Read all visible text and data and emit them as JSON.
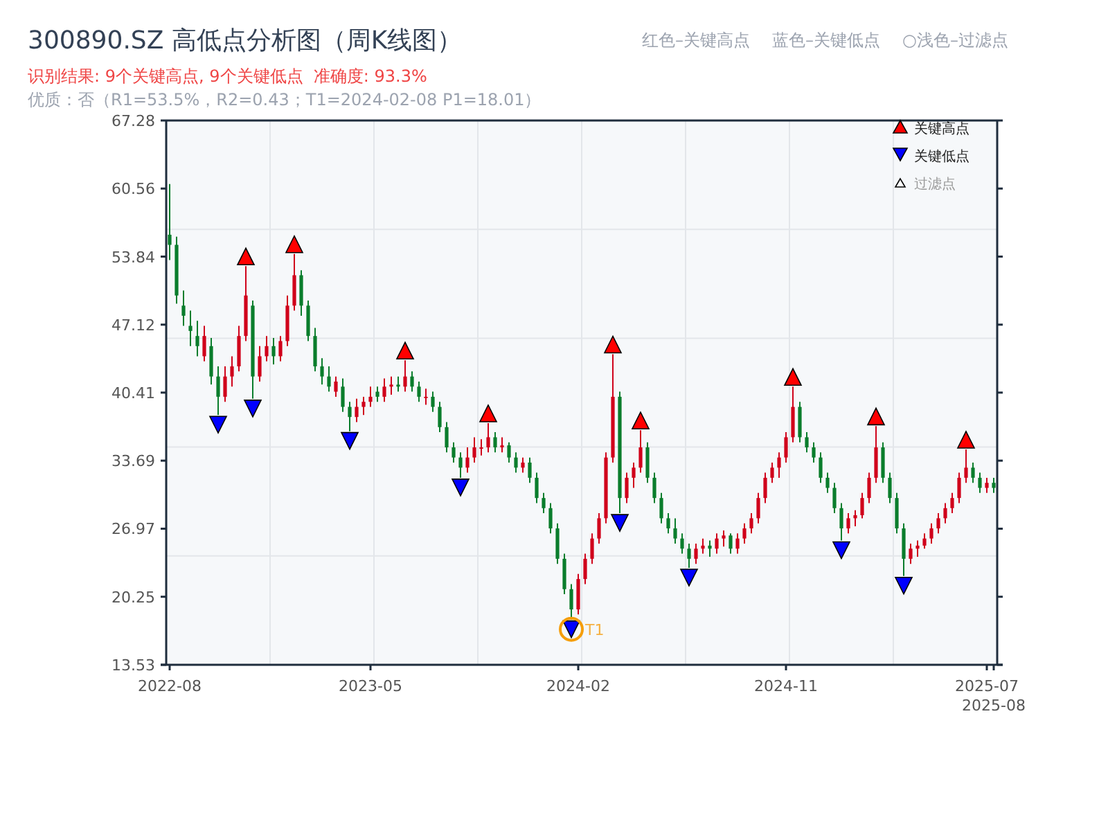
{
  "title": "300890.SZ 高低点分析图（周K线图）",
  "legend_top": [
    "红色–关键高点",
    "蓝色–关键低点",
    "○浅色–过滤点"
  ],
  "result_line": "识别结果: 9个关键高点, 9个关键低点  准确度: 93.3%",
  "quality_line": "优质：否（R1=53.5%，R2=0.43；T1=2024-02-08 P1=18.01）",
  "chart": {
    "chart_data": {
      "type": "candlestick",
      "categories": [
        "2022-08",
        null,
        null,
        null,
        null,
        null,
        null,
        null,
        null,
        null,
        null,
        null,
        null,
        null,
        null,
        null,
        null,
        null,
        null,
        null,
        null,
        null,
        null,
        null,
        null,
        null,
        null,
        null,
        null,
        "2023-05",
        null,
        null,
        null,
        null,
        null,
        null,
        null,
        null,
        null,
        null,
        null,
        null,
        null,
        null,
        null,
        null,
        null,
        null,
        null,
        null,
        null,
        null,
        null,
        null,
        null,
        null,
        null,
        null,
        null,
        "2024-02",
        null,
        null,
        null,
        null,
        null,
        null,
        null,
        null,
        null,
        null,
        null,
        null,
        null,
        null,
        null,
        null,
        null,
        null,
        null,
        null,
        null,
        null,
        null,
        null,
        null,
        null,
        null,
        null,
        null,
        "2024-11",
        null,
        null,
        null,
        null,
        null,
        null,
        null,
        null,
        null,
        null,
        null,
        null,
        null,
        null,
        null,
        null,
        null,
        null,
        null,
        null,
        null,
        null,
        null,
        null,
        null,
        null,
        null,
        null,
        "2025-07",
        "2025-08"
      ],
      "ohlc": [
        [
          56,
          61,
          53.5,
          55
        ],
        [
          55,
          55.8,
          49.2,
          50
        ],
        [
          49,
          50.5,
          47,
          48
        ],
        [
          47,
          48.5,
          45,
          46.5
        ],
        [
          46,
          47.5,
          44,
          45
        ],
        [
          44,
          47,
          43.5,
          46
        ],
        [
          45,
          45.8,
          41.2,
          42
        ],
        [
          42,
          43,
          38.2,
          40
        ],
        [
          40,
          43,
          39.5,
          42
        ],
        [
          42,
          44,
          41,
          43
        ],
        [
          43,
          47,
          42.5,
          46
        ],
        [
          46,
          52.9,
          45.5,
          50
        ],
        [
          49,
          49.5,
          39.8,
          42
        ],
        [
          42,
          45,
          41.5,
          44
        ],
        [
          44,
          46,
          43.5,
          45
        ],
        [
          45,
          45.8,
          43.2,
          44
        ],
        [
          44,
          46,
          43.5,
          45.5
        ],
        [
          45.5,
          50,
          45,
          49
        ],
        [
          49,
          54.1,
          48.5,
          52
        ],
        [
          52,
          52.5,
          48,
          49
        ],
        [
          49,
          49.5,
          45.5,
          46
        ],
        [
          46,
          46.8,
          42.5,
          43
        ],
        [
          43,
          43.8,
          41.2,
          42
        ],
        [
          42,
          43,
          40.5,
          41
        ],
        [
          40.5,
          42,
          40,
          41.5
        ],
        [
          41,
          41.8,
          38.5,
          39
        ],
        [
          39,
          39.5,
          36.6,
          38
        ],
        [
          38,
          39.8,
          37.5,
          39
        ],
        [
          39,
          40,
          38.2,
          39.5
        ],
        [
          39.5,
          41,
          39,
          40
        ],
        [
          40.5,
          41,
          39.5,
          40
        ],
        [
          40,
          41.8,
          39.5,
          41
        ],
        [
          41,
          42,
          40.2,
          41.2
        ],
        [
          41.2,
          42,
          40.5,
          41
        ],
        [
          41,
          43.6,
          40.5,
          42
        ],
        [
          42,
          42.5,
          40.5,
          41
        ],
        [
          41,
          41.5,
          39.5,
          40
        ],
        [
          40,
          40.8,
          39.2,
          40
        ],
        [
          40,
          40.5,
          38.5,
          39
        ],
        [
          39,
          39.5,
          36.5,
          37
        ],
        [
          37,
          37.5,
          34.5,
          35
        ],
        [
          35,
          35.5,
          33.5,
          34
        ],
        [
          34,
          34.5,
          32,
          33
        ],
        [
          33,
          35,
          32.5,
          34
        ],
        [
          34,
          36,
          33.5,
          35
        ],
        [
          35,
          35.8,
          34.2,
          35
        ],
        [
          35,
          37.4,
          34.5,
          36
        ],
        [
          36,
          36.5,
          34.5,
          35
        ],
        [
          35,
          36,
          34.5,
          35.2
        ],
        [
          35.2,
          35.5,
          33.5,
          34
        ],
        [
          34,
          34.5,
          32.5,
          33
        ],
        [
          33,
          34,
          32.5,
          33.5
        ],
        [
          33.5,
          34,
          31.5,
          32
        ],
        [
          32,
          32.5,
          29.5,
          30
        ],
        [
          30,
          30.5,
          28.5,
          29
        ],
        [
          29,
          29.5,
          26.5,
          27
        ],
        [
          27,
          27.5,
          23.5,
          24
        ],
        [
          24,
          24.5,
          20.5,
          21
        ],
        [
          21,
          21.5,
          18,
          19
        ],
        [
          19,
          22.5,
          18.5,
          22
        ],
        [
          22,
          24.5,
          21.5,
          24
        ],
        [
          24,
          26.5,
          23.5,
          26
        ],
        [
          26,
          28.5,
          25.5,
          28
        ],
        [
          28,
          34.5,
          27.5,
          34
        ],
        [
          34,
          44.2,
          33.5,
          40
        ],
        [
          40,
          40.5,
          28.5,
          30
        ],
        [
          30,
          32.5,
          29.5,
          32
        ],
        [
          32,
          33.5,
          31,
          33
        ],
        [
          33,
          36.7,
          32.5,
          35
        ],
        [
          35,
          35.5,
          31.5,
          32
        ],
        [
          32,
          32.5,
          29.5,
          30
        ],
        [
          30,
          30.5,
          27.5,
          28
        ],
        [
          28,
          28.5,
          26.5,
          27
        ],
        [
          27,
          28,
          25.5,
          26
        ],
        [
          26,
          26.5,
          24.5,
          25
        ],
        [
          25,
          25.5,
          23.1,
          24
        ],
        [
          24,
          25.5,
          23.5,
          25
        ],
        [
          25,
          26,
          24.5,
          25.3
        ],
        [
          25.3,
          25.8,
          24.2,
          25
        ],
        [
          25,
          26.5,
          24.5,
          26
        ],
        [
          26,
          26.8,
          25.2,
          26.3
        ],
        [
          26.3,
          26.5,
          24.5,
          25
        ],
        [
          25,
          26.5,
          24.5,
          26
        ],
        [
          26,
          27.5,
          25.5,
          27
        ],
        [
          27,
          28.5,
          26.5,
          28
        ],
        [
          28,
          30.5,
          27.5,
          30
        ],
        [
          30,
          32.5,
          29.5,
          32
        ],
        [
          32,
          33.5,
          31.5,
          33
        ],
        [
          33,
          34.5,
          32,
          34
        ],
        [
          34,
          36.5,
          33.5,
          36
        ],
        [
          36,
          41,
          35.5,
          39
        ],
        [
          39,
          39.5,
          35.5,
          36
        ],
        [
          36,
          36.5,
          34.5,
          35
        ],
        [
          35,
          35.5,
          33.5,
          34
        ],
        [
          34,
          34.5,
          31.5,
          32
        ],
        [
          32,
          32.5,
          30.5,
          31
        ],
        [
          31,
          31.5,
          28.5,
          29
        ],
        [
          29,
          29.5,
          25.8,
          27
        ],
        [
          27,
          28.5,
          26.5,
          28
        ],
        [
          28,
          28.8,
          27.2,
          28.3
        ],
        [
          28.3,
          30.5,
          28,
          30
        ],
        [
          30,
          32.5,
          29.5,
          32
        ],
        [
          32,
          37.1,
          31.5,
          35
        ],
        [
          35,
          35.5,
          31.5,
          32
        ],
        [
          32,
          32.5,
          29.5,
          30
        ],
        [
          30,
          30.5,
          26.5,
          27
        ],
        [
          27,
          27.5,
          22.3,
          24
        ],
        [
          24,
          25.5,
          23.5,
          25
        ],
        [
          25,
          25.8,
          24.2,
          25.3
        ],
        [
          25.3,
          26.5,
          25,
          26
        ],
        [
          26,
          27.5,
          25.5,
          27
        ],
        [
          27,
          28.5,
          26.5,
          28
        ],
        [
          28,
          29.5,
          27.5,
          29
        ],
        [
          29,
          30.5,
          28.5,
          30
        ],
        [
          30,
          32.5,
          29.5,
          32
        ],
        [
          32,
          34.8,
          31.5,
          33
        ],
        [
          33,
          33.5,
          31.5,
          32
        ],
        [
          32,
          32.5,
          30.5,
          31
        ],
        [
          31,
          32,
          30.5,
          31.5
        ],
        [
          31.5,
          32,
          30.5,
          31
        ]
      ],
      "ylim": [
        13.53,
        67.28
      ],
      "yticks": [
        13.53,
        20.25,
        26.97,
        33.69,
        40.41,
        47.12,
        53.84,
        60.56,
        67.28
      ],
      "annotations": [
        "T1"
      ]
    },
    "key_high": [
      false,
      false,
      false,
      false,
      false,
      false,
      false,
      false,
      false,
      false,
      false,
      true,
      false,
      false,
      false,
      false,
      false,
      false,
      true,
      false,
      false,
      false,
      false,
      false,
      false,
      false,
      false,
      false,
      false,
      false,
      false,
      false,
      false,
      false,
      true,
      false,
      false,
      false,
      false,
      false,
      false,
      false,
      false,
      false,
      false,
      false,
      true,
      false,
      false,
      false,
      false,
      false,
      false,
      false,
      false,
      false,
      false,
      false,
      false,
      false,
      false,
      false,
      false,
      false,
      true,
      false,
      false,
      false,
      true,
      false,
      false,
      false,
      false,
      false,
      false,
      false,
      false,
      false,
      false,
      false,
      false,
      false,
      false,
      false,
      false,
      false,
      false,
      false,
      false,
      false,
      true,
      false,
      false,
      false,
      false,
      false,
      false,
      false,
      false,
      false,
      false,
      false,
      true,
      false,
      false,
      false,
      false,
      false,
      false,
      false,
      false,
      false,
      false,
      false,
      false,
      true,
      false,
      false,
      false,
      false
    ],
    "key_low": [
      false,
      false,
      false,
      false,
      false,
      false,
      false,
      true,
      false,
      false,
      false,
      false,
      true,
      false,
      false,
      false,
      false,
      false,
      false,
      false,
      false,
      false,
      false,
      false,
      false,
      false,
      true,
      false,
      false,
      false,
      false,
      false,
      false,
      false,
      false,
      false,
      false,
      false,
      false,
      false,
      false,
      false,
      true,
      false,
      false,
      false,
      false,
      false,
      false,
      false,
      false,
      false,
      false,
      false,
      false,
      false,
      false,
      false,
      true,
      false,
      false,
      false,
      false,
      false,
      false,
      true,
      false,
      false,
      false,
      false,
      false,
      false,
      false,
      false,
      false,
      true,
      false,
      false,
      false,
      false,
      false,
      false,
      false,
      false,
      false,
      false,
      false,
      false,
      false,
      false,
      false,
      false,
      false,
      false,
      false,
      false,
      false,
      true,
      false,
      false,
      false,
      false,
      false,
      false,
      false,
      false,
      true,
      false,
      false,
      false,
      false,
      false,
      false,
      false,
      false,
      false,
      false,
      false,
      false,
      false
    ],
    "legend": [
      {
        "label": "关键高点",
        "kind": "high",
        "color": "#ff0000"
      },
      {
        "label": "关键低点",
        "kind": "low",
        "color": "#0000ff"
      },
      {
        "label": "过滤点",
        "kind": "filtered"
      }
    ]
  }
}
